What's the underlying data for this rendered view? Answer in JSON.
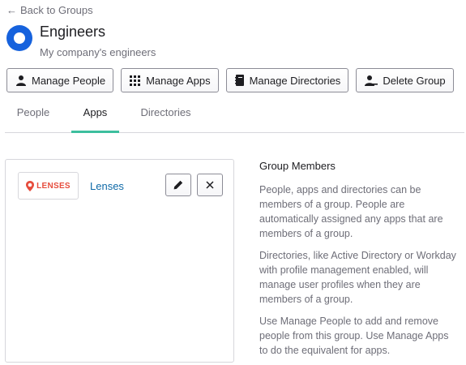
{
  "nav": {
    "back_label": "Back to Groups"
  },
  "group": {
    "title": "Engineers",
    "description": "My company's engineers"
  },
  "toolbar": {
    "manage_people": "Manage People",
    "manage_apps": "Manage Apps",
    "manage_directories": "Manage Directories",
    "delete_group": "Delete Group"
  },
  "tabs": [
    {
      "label": "People",
      "active": false
    },
    {
      "label": "Apps",
      "active": true
    },
    {
      "label": "Directories",
      "active": false
    }
  ],
  "apps": [
    {
      "logo_text": "LENSES",
      "name": "Lenses"
    }
  ],
  "help": {
    "title": "Group Members",
    "paragraphs": [
      "People, apps and directories can be members of a group. People are automatically assigned any apps that are members of a group.",
      "Directories, like Active Directory or Workday with profile management enabled, will manage user profiles when they are members of a group.",
      "Use Manage People to add and remove people from this group. Use Manage Apps to do the equivalent for apps."
    ]
  },
  "colors": {
    "accent_tab": "#3dbf9e",
    "group_logo": "#1662dd",
    "lenses_brand": "#e64c3c",
    "link": "#0f6aa8"
  }
}
